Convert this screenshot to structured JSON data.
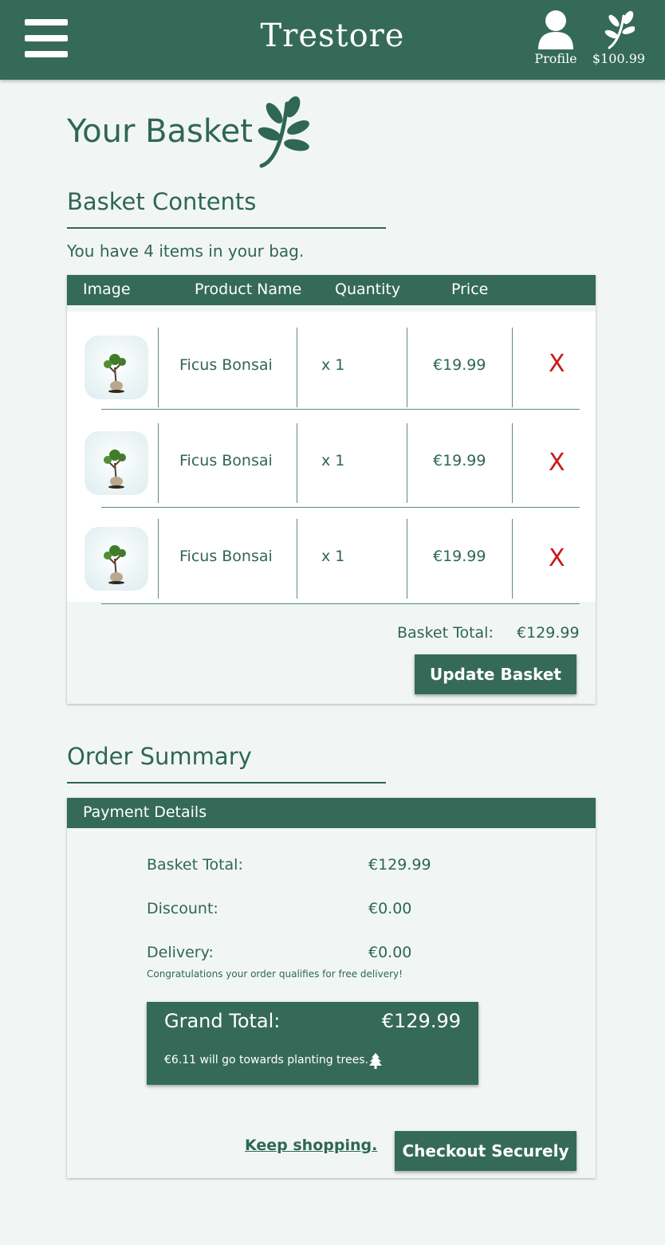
{
  "header": {
    "brand": "Trestore",
    "profile_label": "Profile",
    "balance": "$100.99"
  },
  "page": {
    "title": "Your Basket"
  },
  "basket": {
    "heading": "Basket Contents",
    "items_count_text": "You have 4 items in your bag.",
    "columns": [
      "Image",
      "Product Name",
      "Quantity",
      "Price"
    ],
    "rows": [
      {
        "name": "Ficus Bonsai",
        "quantity": "x 1",
        "price": "€19.99",
        "remove": "X"
      },
      {
        "name": "Ficus Bonsai",
        "quantity": "x 1",
        "price": "€19.99",
        "remove": "X"
      },
      {
        "name": "Ficus Bonsai",
        "quantity": "x 1",
        "price": "€19.99",
        "remove": "X"
      }
    ],
    "total_label": "Basket Total:",
    "total_value": "€129.99",
    "update_button": "Update Basket"
  },
  "summary": {
    "heading": "Order Summary",
    "panel_title": "Payment Details",
    "basket_total_label": "Basket Total:",
    "basket_total_value": "€129.99",
    "discount_label": "Discount:",
    "discount_value": "€0.00",
    "delivery_label": "Delivery:",
    "delivery_value": "€0.00",
    "delivery_note": "Congratulations your order qualifies for free delivery!",
    "grand_total_label": "Grand Total:",
    "grand_total_value": "€129.99",
    "trees_note": "€6.11 will go towards planting trees.",
    "keep_shopping": "Keep shopping.",
    "checkout_button": "Checkout Securely"
  },
  "colors": {
    "brand_green": "#356a58",
    "background": "#f1f6f5",
    "remove_red": "#c8181c"
  },
  "icons": [
    "menu-icon",
    "user-icon",
    "leaf-icon",
    "tree-icon"
  ]
}
